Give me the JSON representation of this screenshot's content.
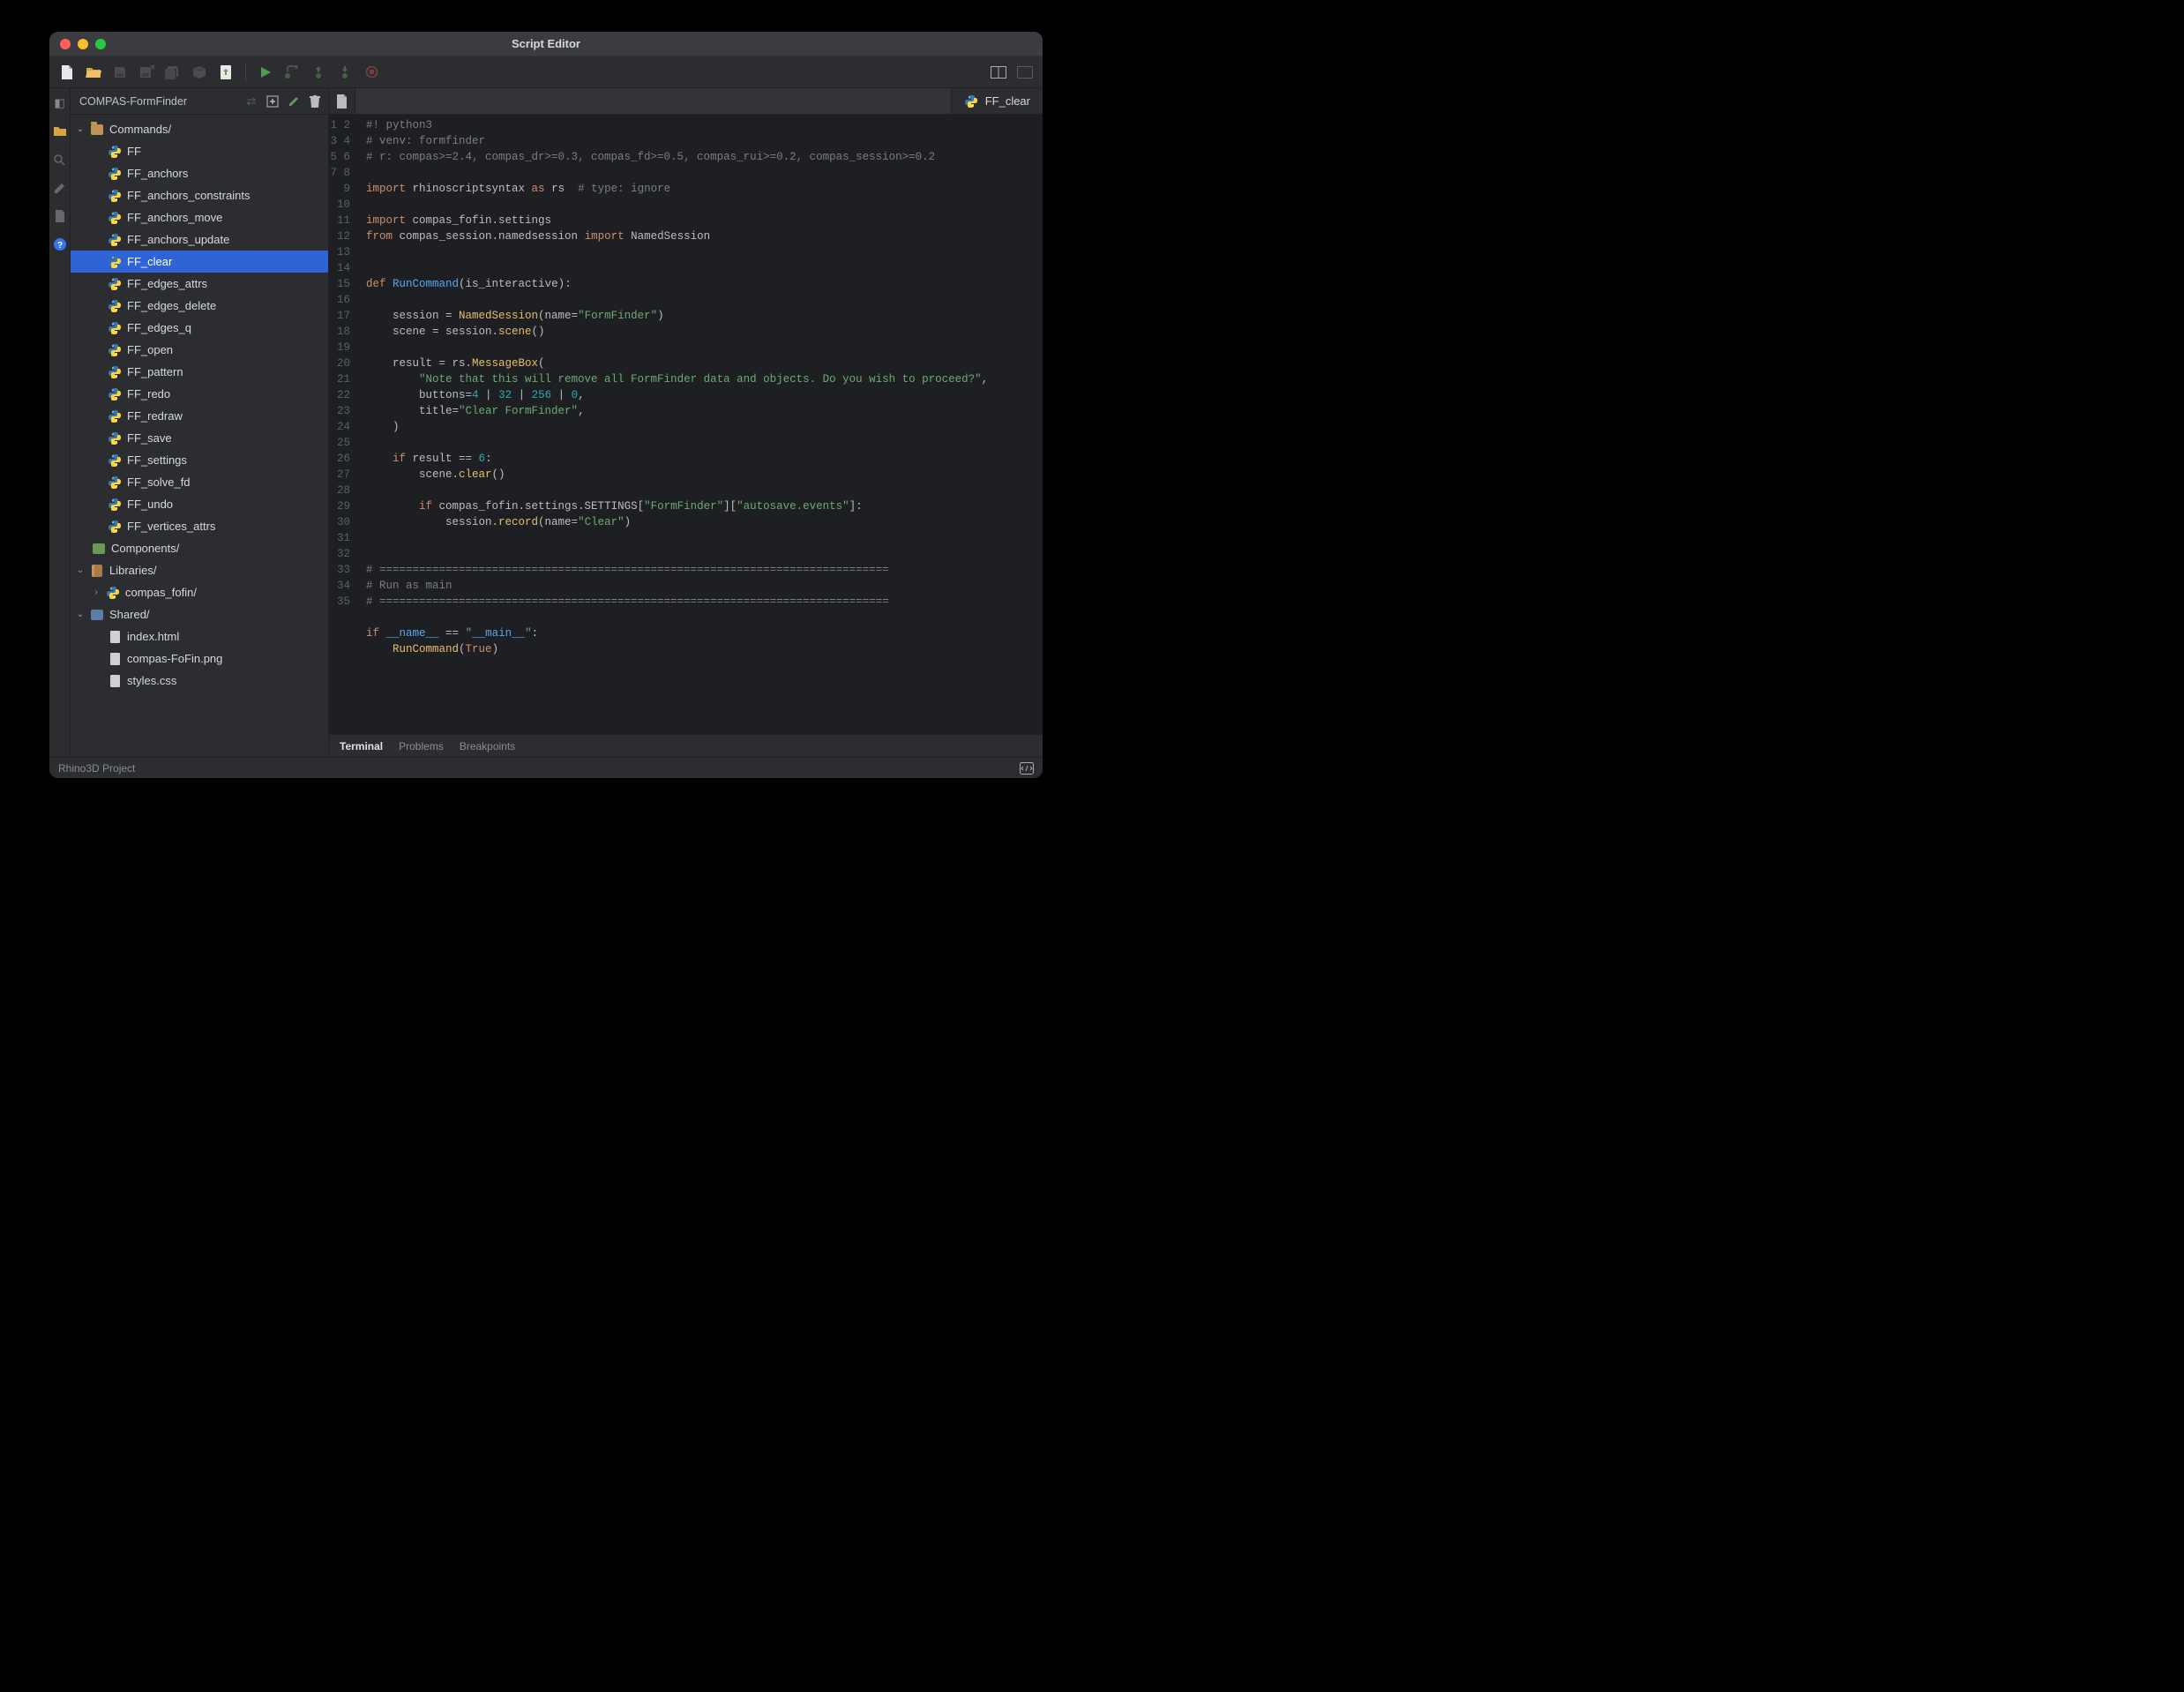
{
  "window": {
    "title": "Script Editor"
  },
  "statusbar": {
    "left": "Rhino3D Project"
  },
  "sidebar": {
    "project": "COMPAS-FormFinder",
    "tree": {
      "commands_label": "Commands/",
      "components_label": "Components/",
      "libraries_label": "Libraries/",
      "compas_fofin_label": "compas_fofin/",
      "shared_label": "Shared/",
      "commands": [
        "FF",
        "FF_anchors",
        "FF_anchors_constraints",
        "FF_anchors_move",
        "FF_anchors_update",
        "FF_clear",
        "FF_edges_attrs",
        "FF_edges_delete",
        "FF_edges_q",
        "FF_open",
        "FF_pattern",
        "FF_redo",
        "FF_redraw",
        "FF_save",
        "FF_settings",
        "FF_solve_fd",
        "FF_undo",
        "FF_vertices_attrs"
      ],
      "selected_index": 5,
      "shared": [
        "index.html",
        "compas-FoFin.png",
        "styles.css"
      ]
    }
  },
  "tabs": {
    "active": "FF_clear"
  },
  "bottom_tabs": {
    "items": [
      "Terminal",
      "Problems",
      "Breakpoints"
    ],
    "active": 0
  },
  "code": {
    "line_count": 35,
    "raw": [
      "#! python3",
      "# venv: formfinder",
      "# r: compas>=2.4, compas_dr>=0.3, compas_fd>=0.5, compas_rui>=0.2, compas_session>=0.2",
      "",
      "import rhinoscriptsyntax as rs  # type: ignore",
      "",
      "import compas_fofin.settings",
      "from compas_session.namedsession import NamedSession",
      "",
      "",
      "def RunCommand(is_interactive):",
      "",
      "    session = NamedSession(name=\"FormFinder\")",
      "    scene = session.scene()",
      "",
      "    result = rs.MessageBox(",
      "        \"Note that this will remove all FormFinder data and objects. Do you wish to proceed?\",",
      "        buttons=4 | 32 | 256 | 0,",
      "        title=\"Clear FormFinder\",",
      "    )",
      "",
      "    if result == 6:",
      "        scene.clear()",
      "",
      "        if compas_fofin.settings.SETTINGS[\"FormFinder\"][\"autosave.events\"]:",
      "            session.record(name=\"Clear\")",
      "",
      "",
      "# =============================================================================",
      "# Run as main",
      "# =============================================================================",
      "",
      "if __name__ == \"__main__\":",
      "    RunCommand(True)",
      ""
    ]
  }
}
